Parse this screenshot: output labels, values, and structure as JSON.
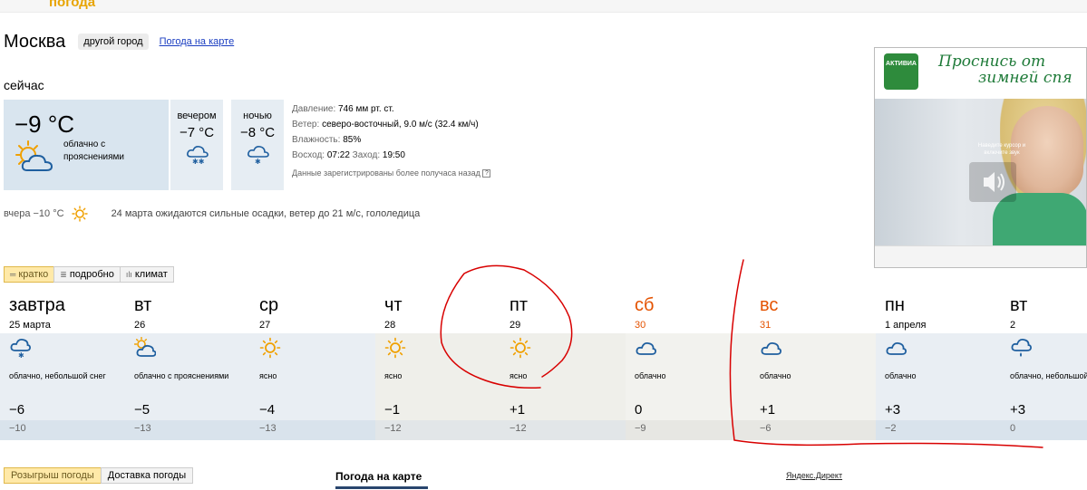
{
  "header": {
    "brand": "погода"
  },
  "city": {
    "name": "Москва",
    "other_city": "другой город",
    "map_link": "Погода на карте"
  },
  "now": {
    "label": "сейчас",
    "temp": "−9 °C",
    "icon": "partly-cloudy-icon",
    "desc": "облачно с прояснениями",
    "evening": {
      "label": "вечером",
      "temp": "−7 °C",
      "icon": "cloud-snow-icon"
    },
    "night": {
      "label": "ночью",
      "temp": "−8 °C",
      "icon": "cloud-snow-icon"
    },
    "details": {
      "pressure_label": "Давление:",
      "pressure": "746 мм рт. ст.",
      "wind_label": "Ветер:",
      "wind": "северо-восточный, 9.0 м/с (32.4 км/ч)",
      "humidity_label": "Влажность:",
      "humidity": "85%",
      "sunrise_label": "Восход:",
      "sunrise": "07:22",
      "sunset_label": "Заход:",
      "sunset": "19:50",
      "note": "Данные зарегистрированы более получаса назад",
      "help": "?"
    }
  },
  "yesterday": {
    "text": "вчера −10 °C",
    "icon": "sun-icon",
    "warning": "24 марта ожидаются сильные осадки, ветер до 21 м/с, гололедица"
  },
  "ad": {
    "logo": "АКТИВИА",
    "slogan_1": "Проснись от",
    "slogan_2": "зимней спя",
    "hint": "Наведите курсор и включите звук"
  },
  "tabs": [
    {
      "label": "кратко",
      "glyph": "═"
    },
    {
      "label": "подробно",
      "glyph": "≣"
    },
    {
      "label": "климат",
      "glyph": "ılı"
    }
  ],
  "forecast": [
    {
      "name": "завтра",
      "date": "25 марта",
      "icon": "cloud-snow-icon",
      "desc": "облачно, небольшой снег",
      "day": "−6",
      "night": "−10",
      "weekend": false,
      "bg": "#e9eef3",
      "night_bg": "#d9e3ec"
    },
    {
      "name": "вт",
      "date": "26",
      "icon": "partly-cloudy-icon",
      "desc": "облачно с прояснениями",
      "day": "−5",
      "night": "−13",
      "weekend": false,
      "bg": "#e9eef3",
      "night_bg": "#d9e3ec"
    },
    {
      "name": "ср",
      "date": "27",
      "icon": "sun-icon",
      "desc": "ясно",
      "day": "−4",
      "night": "−13",
      "weekend": false,
      "bg": "#e9eef3",
      "night_bg": "#d9e3ec"
    },
    {
      "name": "чт",
      "date": "28",
      "icon": "sun-icon",
      "desc": "ясно",
      "day": "−1",
      "night": "−12",
      "weekend": false,
      "bg": "#efefea",
      "night_bg": "#e2e6e8"
    },
    {
      "name": "пт",
      "date": "29",
      "icon": "sun-icon",
      "desc": "ясно",
      "day": "+1",
      "night": "−12",
      "weekend": false,
      "bg": "#efefea",
      "night_bg": "#e2e6e8"
    },
    {
      "name": "сб",
      "date": "30",
      "icon": "cloud-icon",
      "desc": "облачно",
      "day": "0",
      "night": "−9",
      "weekend": true,
      "bg": "#f2f2ee",
      "night_bg": "#e7e7e3"
    },
    {
      "name": "вс",
      "date": "31",
      "icon": "cloud-icon",
      "desc": "облачно",
      "day": "+1",
      "night": "−6",
      "weekend": true,
      "bg": "#f2f2ee",
      "night_bg": "#e7e7e3"
    },
    {
      "name": "пн",
      "date": "1 апреля",
      "icon": "cloud-icon",
      "desc": "облачно",
      "day": "+3",
      "night": "−2",
      "weekend": false,
      "bg": "#e9eef3",
      "night_bg": "#d9e3ec"
    },
    {
      "name": "вт",
      "date": "2",
      "icon": "cloud-rain-icon",
      "desc": "облачно, небольшой дождь",
      "day": "+3",
      "night": "0",
      "weekend": false,
      "bg": "#e9eef3",
      "night_bg": "#d9e3ec"
    }
  ],
  "bottom": {
    "tab1": "Розыгрыш погоды",
    "tab2": "Доставка погоды",
    "map": "Погода на карте",
    "direct": "Яндекс.Директ"
  },
  "colors": {
    "accent": "#e8a400",
    "weekend": "#e45200",
    "link": "#1a3dc1",
    "annotation": "#d80000"
  }
}
